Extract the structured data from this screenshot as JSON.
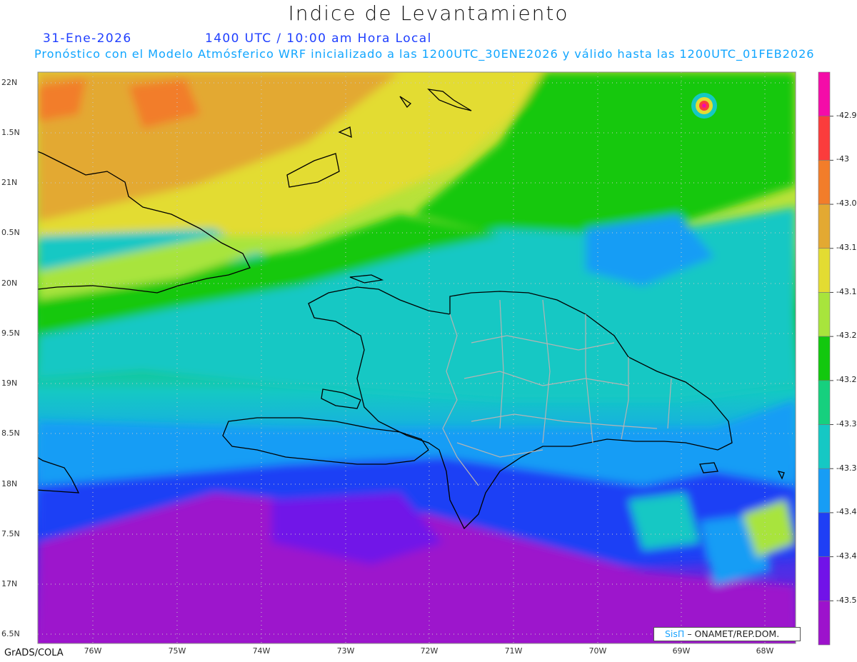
{
  "header": {
    "title": "Indice de Levantamiento",
    "date": "31-Ene-2026",
    "time": "1400 UTC / 10:00 am Hora Local",
    "subtitle": "Pronóstico con el Modelo Atmósferico WRF inicializado a las 1200UTC_30ENE2026 y válido hasta las  1200UTC_01FEB2026"
  },
  "map": {
    "lat_labels": [
      "22N",
      "1.5N",
      "21N",
      "0.5N",
      "20N",
      "9.5N",
      "19N",
      "8.5N",
      "18N",
      "7.5N",
      "17N",
      "6.5N"
    ],
    "lon_labels": [
      "76W",
      "75W",
      "74W",
      "73W",
      "72W",
      "71W",
      "70W",
      "69W",
      "68W"
    ]
  },
  "legend": {
    "labels": [
      "-42.9",
      "-43",
      "-43.0",
      "-43.1",
      "-43.1",
      "-43.2",
      "-43.2",
      "-43.3",
      "-43.3",
      "-43.4",
      "-43.4",
      "-43.5"
    ],
    "colors": [
      "#f40ca8",
      "#fb3c3c",
      "#f27d2a",
      "#e3a932",
      "#e3dc32",
      "#a8e43c",
      "#12c80e",
      "#16d07e",
      "#15c8c4",
      "#179df5",
      "#1f3ff5",
      "#7112e8",
      "#9d12cc"
    ]
  },
  "footer": {
    "software": "GrADS/COLA",
    "credit_brand": "SisΠ",
    "credit_org": "– ONAMET/REP.DOM."
  }
}
